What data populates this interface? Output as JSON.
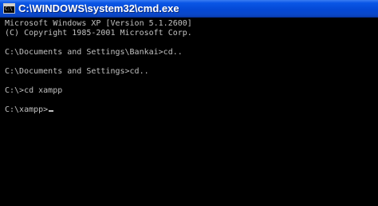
{
  "window": {
    "title": "C:\\WINDOWS\\system32\\cmd.exe",
    "icon_name": "cmd-icon",
    "icon_text": "C:\\"
  },
  "console": {
    "text_color": "#c0c0c0",
    "background_color": "#000000",
    "lines": [
      "Microsoft Windows XP [Version 5.1.2600]",
      "(C) Copyright 1985-2001 Microsoft Corp.",
      "",
      "C:\\Documents and Settings\\Bankai>cd..",
      "",
      "C:\\Documents and Settings>cd..",
      "",
      "C:\\>cd xampp",
      "",
      "C:\\xampp>"
    ]
  }
}
